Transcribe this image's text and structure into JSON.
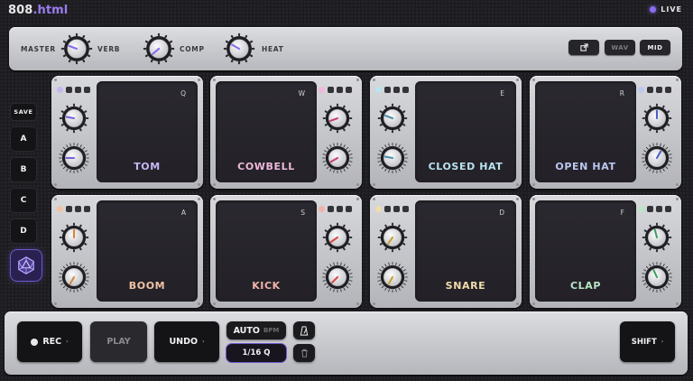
{
  "header": {
    "title_name": "808",
    "title_ext": ".html",
    "live_label": "LIVE"
  },
  "top_panel": {
    "master_label": "MASTER",
    "knobs": [
      {
        "label": "VERB",
        "indicator_color": "#8b6cf0"
      },
      {
        "label": "COMP",
        "indicator_color": "#8b6cf0"
      },
      {
        "label": "HEAT",
        "indicator_color": "#8b6cf0"
      }
    ],
    "share_icon": "external-link-icon",
    "wav_label": "WAV",
    "mid_label": "MID"
  },
  "sidebar": {
    "save_label": "SAVE",
    "banks": [
      "A",
      "B",
      "C",
      "D"
    ],
    "logo_icon": "d20-icon"
  },
  "pads": [
    {
      "name": "TOM",
      "key": "Q",
      "color": "#c7b7f3"
    },
    {
      "name": "COWBELL",
      "key": "W",
      "color": "#f0b8dc"
    },
    {
      "name": "CLOSED HAT",
      "key": "E",
      "color": "#b8e3ef"
    },
    {
      "name": "OPEN HAT",
      "key": "R",
      "color": "#bcc8f2"
    },
    {
      "name": "BOOM",
      "key": "A",
      "color": "#f2c2a3"
    },
    {
      "name": "KICK",
      "key": "S",
      "color": "#f0b2aa"
    },
    {
      "name": "SNARE",
      "key": "D",
      "color": "#f1dcaa"
    },
    {
      "name": "CLAP",
      "key": "F",
      "color": "#b9e6c7"
    }
  ],
  "transport": {
    "rec_label": "REC",
    "play_label": "PLAY",
    "undo_label": "UNDO",
    "auto_label": "AUTO",
    "bpm_label": "BPM",
    "quantize_label": "1/16 Q",
    "metronome_icon": "metronome-icon",
    "trash_icon": "trash-icon",
    "shift_label": "SHIFT"
  }
}
